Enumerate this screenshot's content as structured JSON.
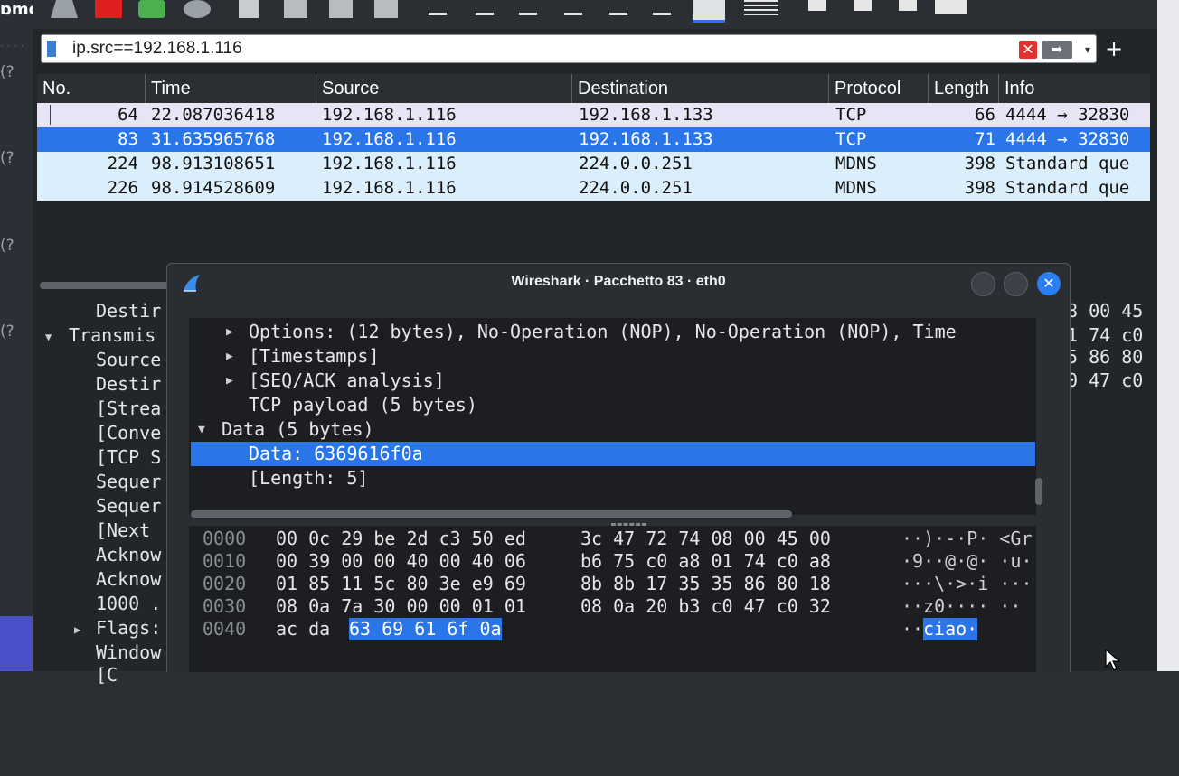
{
  "desktop": {
    "tab_label": "ɒmc",
    "side_labels": [
      "(?",
      "(?",
      "(?",
      "(?"
    ]
  },
  "filter": {
    "value": "ip.src==192.168.1.116"
  },
  "packet_list": {
    "columns": [
      "No.",
      "Time",
      "Source",
      "Destination",
      "Protocol",
      "Length",
      "Info"
    ],
    "rows": [
      {
        "no": "64",
        "time": "22.087036418",
        "source": "192.168.1.116",
        "destination": "192.168.1.133",
        "protocol": "TCP",
        "length": "66",
        "info": "4444 → 32830"
      },
      {
        "no": "83",
        "time": "31.635965768",
        "source": "192.168.1.116",
        "destination": "192.168.1.133",
        "protocol": "TCP",
        "length": "71",
        "info": "4444 → 32830"
      },
      {
        "no": "224",
        "time": "98.913108651",
        "source": "192.168.1.116",
        "destination": "224.0.0.251",
        "protocol": "MDNS",
        "length": "398",
        "info": "Standard que"
      },
      {
        "no": "226",
        "time": "98.914528609",
        "source": "192.168.1.116",
        "destination": "224.0.0.251",
        "protocol": "MDNS",
        "length": "398",
        "info": "Standard que"
      }
    ]
  },
  "background_details": {
    "rows": [
      "Destir",
      "Transmis",
      "Source",
      "Destir",
      "[Strea",
      "[Conve",
      "[TCP S",
      "Sequer",
      "Sequer",
      "[Next",
      "Acknow",
      "Acknow",
      "1000 .",
      "Flags:",
      "Window",
      "[C"
    ],
    "bytes_right": [
      "8 00 45",
      "1 74 c0",
      "5 86 80",
      "0 47 c0"
    ]
  },
  "dialog": {
    "title": "Wireshark · Pacchetto 83 · eth0",
    "tree": [
      {
        "text": "Options: (12 bytes), No-Operation (NOP), No-Operation (NOP), Time",
        "expand": "collapsed"
      },
      {
        "text": "[Timestamps]",
        "expand": "collapsed"
      },
      {
        "text": "[SEQ/ACK analysis]",
        "expand": "collapsed"
      },
      {
        "text": "TCP payload (5 bytes)",
        "expand": "none"
      },
      {
        "text": "Data (5 bytes)",
        "expand": "expanded"
      },
      {
        "text": "Data: 6369616f0a",
        "expand": "none",
        "selected": true
      },
      {
        "text": "[Length: 5]",
        "expand": "none"
      }
    ],
    "bytes": [
      {
        "offset": "0000",
        "hex1": "00 0c 29 be 2d c3 50 ed",
        "hex2": "3c 47 72 74 08 00 45 00",
        "ascii": "··)·-·P· <Gr"
      },
      {
        "offset": "0010",
        "hex1": "00 39 00 00 40 00 40 06",
        "hex2": "b6 75 c0 a8 01 74 c0 a8",
        "ascii": "·9··@·@· ·u·"
      },
      {
        "offset": "0020",
        "hex1": "01 85 11 5c 80 3e e9 69",
        "hex2": "8b 8b 17 35 35 86 80 18",
        "ascii": "···\\·>·i ···"
      },
      {
        "offset": "0030",
        "hex1": "08 0a 7a 30 00 00 01 01",
        "hex2": "08 0a 20 b3 c0 47 c0 32",
        "ascii": "··z0···· ··"
      },
      {
        "offset": "0040",
        "hex1": "ac da",
        "hex_hl": "63 69 61 6f 0a",
        "ascii_pre": "··",
        "ascii_hl": "ciao·"
      }
    ]
  },
  "colors": {
    "selection": "#2a76e8",
    "row_normal": "#e8e4f5",
    "row_light": "#daeefc"
  }
}
